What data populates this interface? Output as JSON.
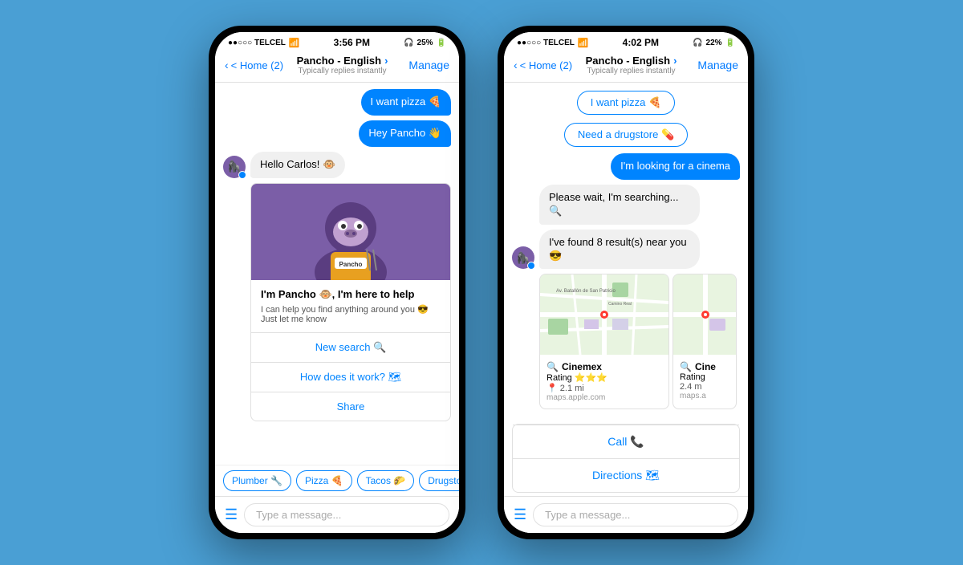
{
  "phone1": {
    "status": {
      "carrier": "●●○○○ TELCEL",
      "wifi": "WiFi",
      "time": "3:56 PM",
      "battery": "25%"
    },
    "nav": {
      "back": "< Home (2)",
      "title": "Pancho - English",
      "title_arrow": ">",
      "subtitle": "Typically replies instantly",
      "manage": "Manage"
    },
    "messages": [
      {
        "type": "sent",
        "text": "I want pizza 🍕"
      },
      {
        "type": "sent",
        "text": "Hey Pancho 👋"
      },
      {
        "type": "received",
        "text": "Hello Carlos! 🐵"
      }
    ],
    "bot_card": {
      "title": "I'm Pancho 🐵, I'm here to help",
      "desc_line1": "I can help you find anything around you 😎",
      "desc_line2": "Just let me know",
      "actions": [
        {
          "label": "New search 🔍"
        },
        {
          "label": "How does it work? 🗺"
        },
        {
          "label": "Share"
        }
      ]
    },
    "quick_replies": [
      {
        "label": "Plumber 🔧"
      },
      {
        "label": "Pizza 🍕"
      },
      {
        "label": "Tacos 🌮"
      },
      {
        "label": "Drugstore"
      }
    ],
    "input_placeholder": "Type a message..."
  },
  "phone2": {
    "status": {
      "carrier": "●●○○○ TELCEL",
      "wifi": "WiFi",
      "time": "4:02 PM",
      "battery": "22%"
    },
    "nav": {
      "back": "< Home (2)",
      "title": "Pancho - English",
      "title_arrow": ">",
      "subtitle": "Typically replies instantly",
      "manage": "Manage"
    },
    "messages": [
      {
        "type": "sent",
        "text": "I want pizza 🍕"
      },
      {
        "type": "sent",
        "text": "Need a drugstore 💊"
      },
      {
        "type": "sent",
        "text": "I'm looking for a cinema"
      },
      {
        "type": "received",
        "text": "Please wait, I'm searching... 🔍"
      },
      {
        "type": "received",
        "text": "I've found 8 result(s) near you 😎"
      }
    ],
    "cards": [
      {
        "name": "Cinemex",
        "rating": "⭐⭐⭐",
        "distance": "2.1 mi",
        "link": "maps.apple.com"
      },
      {
        "name": "Cine",
        "rating": "Rating",
        "distance": "2.4 m",
        "link": "maps.a"
      }
    ],
    "actions": [
      {
        "label": "Call 📞"
      },
      {
        "label": "Directions 🗺"
      }
    ],
    "input_placeholder": "Type a message..."
  }
}
